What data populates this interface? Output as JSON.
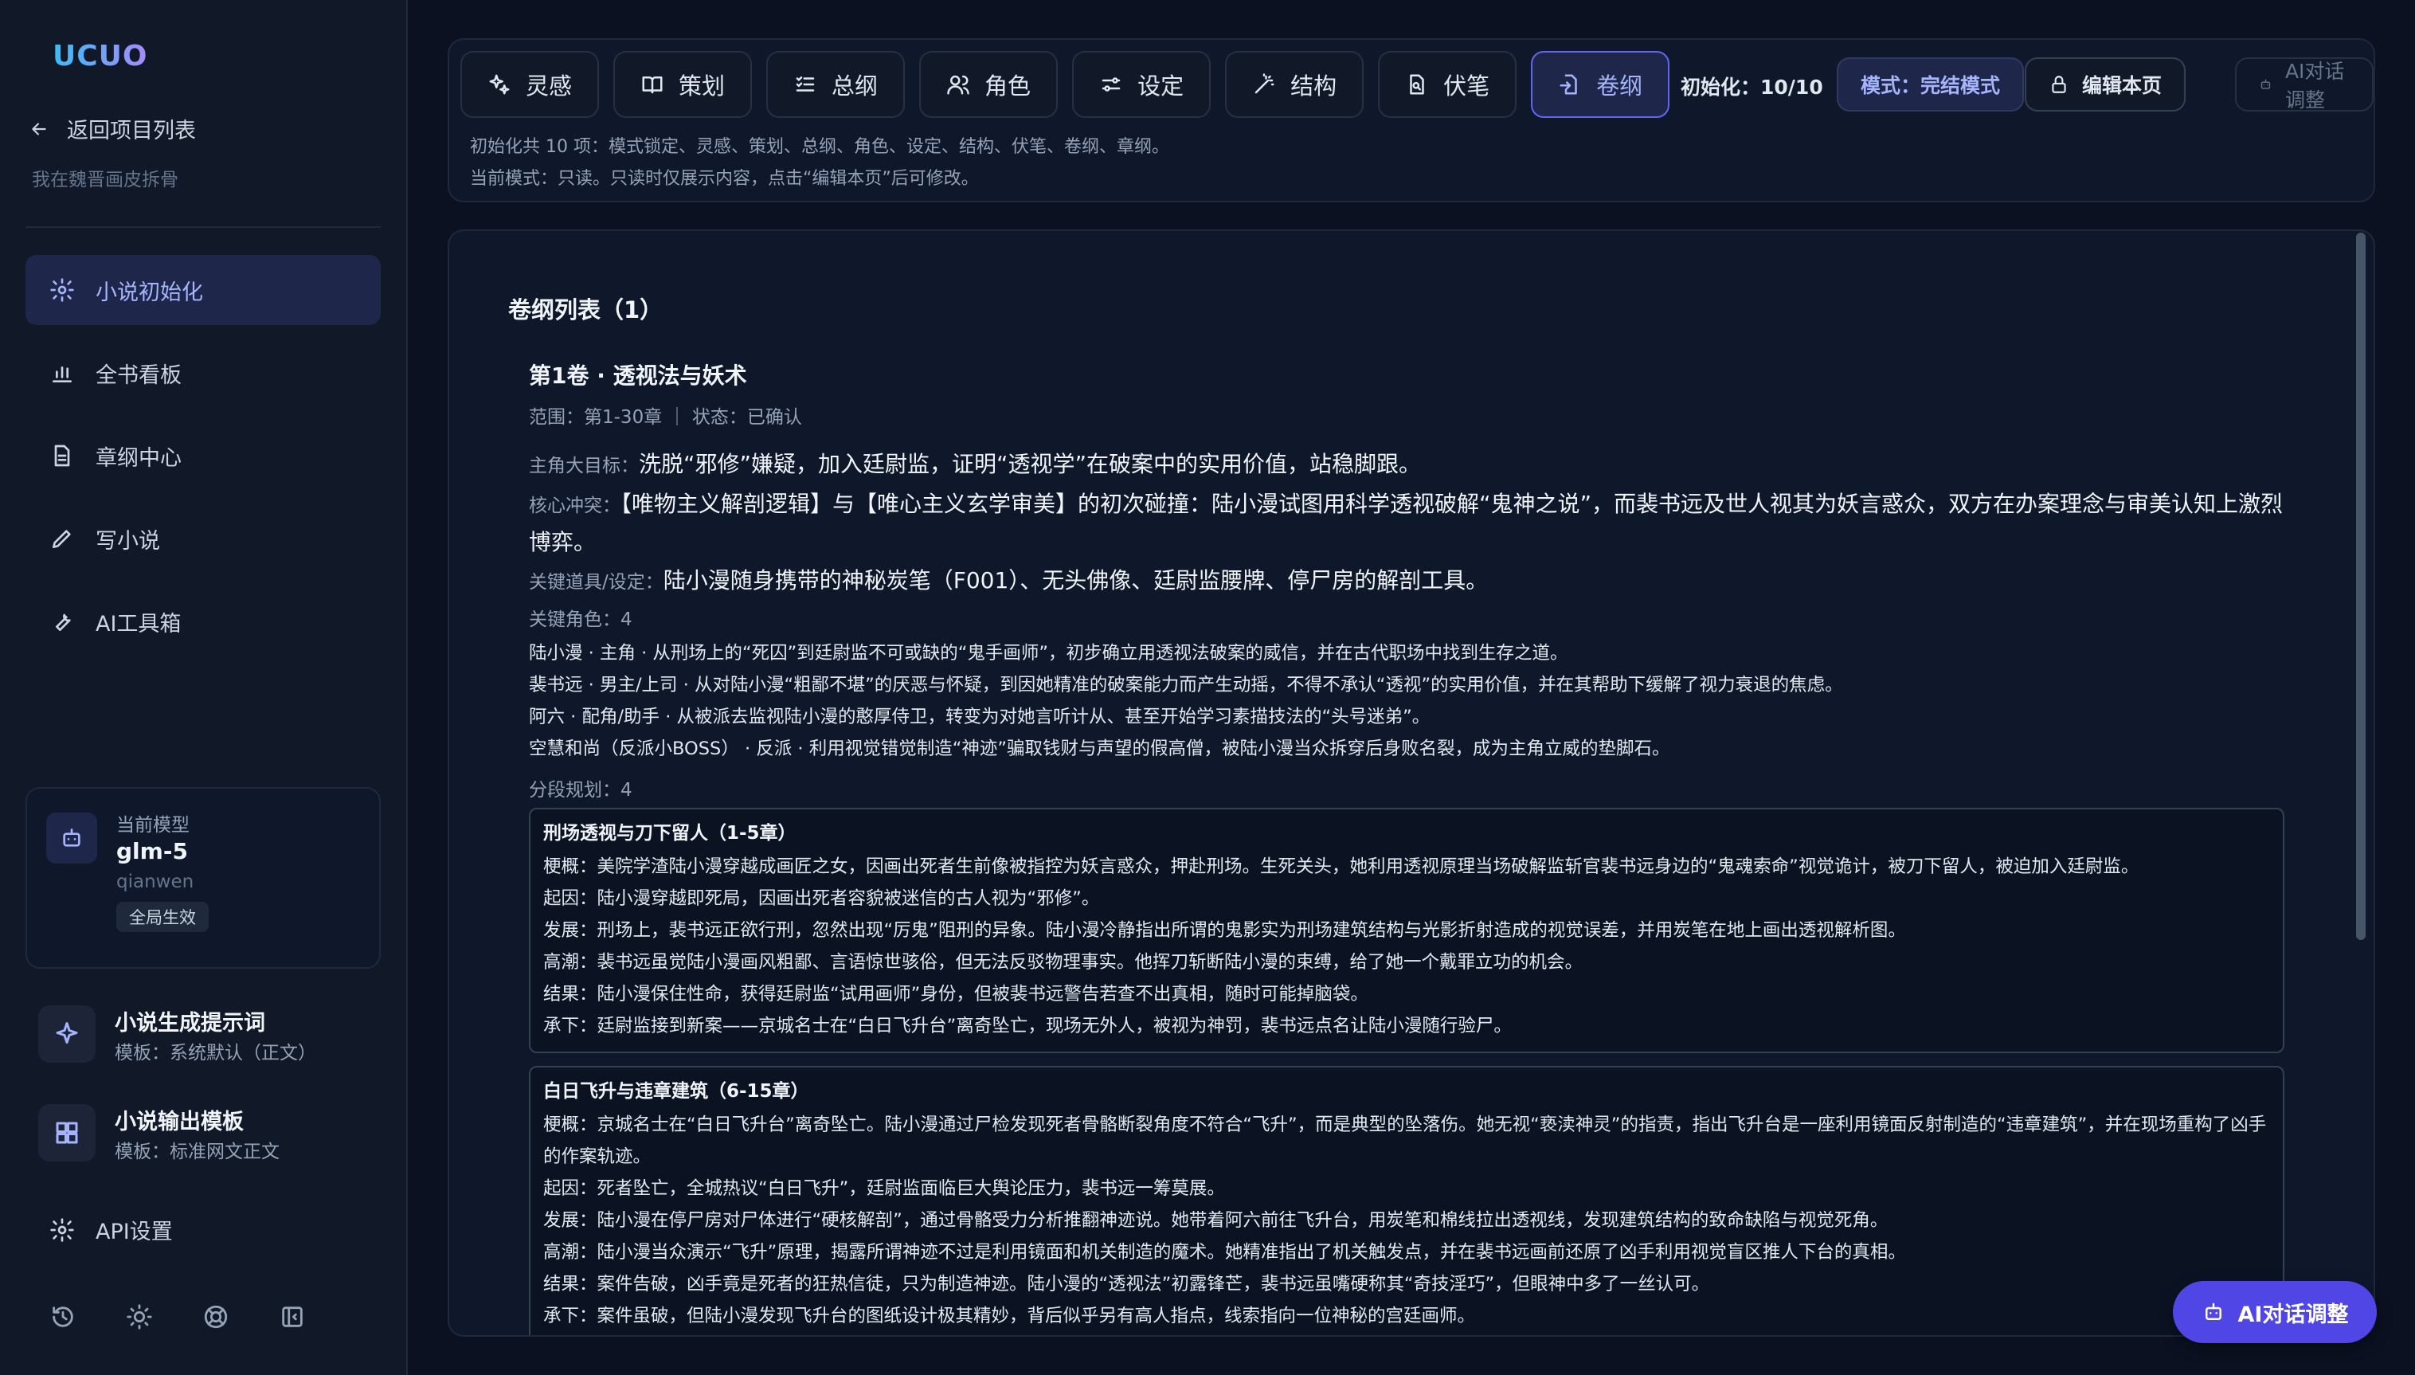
{
  "sidebar": {
    "logo": "UCUO",
    "back": "返回项目列表",
    "project": "我在魏晋画皮拆骨",
    "nav": [
      {
        "label": "小说初始化",
        "icon": "gear-icon"
      },
      {
        "label": "全书看板",
        "icon": "bar-chart-icon"
      },
      {
        "label": "章纲中心",
        "icon": "document-icon"
      },
      {
        "label": "写小说",
        "icon": "pencil-icon"
      },
      {
        "label": "AI工具箱",
        "icon": "wrench-icon"
      }
    ],
    "model": {
      "label": "当前模型",
      "name": "glm-5",
      "provider": "qianwen",
      "badge": "全局生效"
    },
    "prompt_tpl": {
      "title": "小说生成提示词",
      "sub": "模板：系统默认（正文）"
    },
    "output_tpl": {
      "title": "小说输出模板",
      "sub": "模板：标准网文正文"
    },
    "api": "API设置"
  },
  "toolbar": {
    "tabs": [
      {
        "label": "灵感",
        "icon": "sparkle-icon"
      },
      {
        "label": "策划",
        "icon": "book-open-icon"
      },
      {
        "label": "总纲",
        "icon": "list-check-icon"
      },
      {
        "label": "角色",
        "icon": "users-icon"
      },
      {
        "label": "设定",
        "icon": "sliders-icon"
      },
      {
        "label": "结构",
        "icon": "wand-icon"
      },
      {
        "label": "伏笔",
        "icon": "file-search-icon"
      },
      {
        "label": "卷纲",
        "icon": "file-import-icon"
      }
    ],
    "init_count": "初始化：10/10",
    "mode": "模式：完结模式",
    "edit": "编辑本页",
    "ai": "AI对话调整",
    "hint1": "初始化共 10 项：模式锁定、灵感、策划、总纲、角色、设定、结构、伏笔、卷纲、章纲。",
    "hint2": "当前模式：只读。只读时仅展示内容，点击“编辑本页”后可修改。"
  },
  "main": {
    "list_title": "卷纲列表（1）",
    "volume": {
      "title": "第1卷 · 透视法与妖术",
      "meta": "范围：第1-30章 ｜ 状态：已确认",
      "goal_label": "主角大目标：",
      "goal": "洗脱“邪修”嫌疑，加入廷尉监，证明“透视学”在破案中的实用价值，站稳脚跟。",
      "conflict_label": "核心冲突：",
      "conflict": "【唯物主义解剖逻辑】与【唯心主义玄学审美】的初次碰撞：陆小漫试图用科学透视破解“鬼神之说”，而裴书远及世人视其为妖言惑众，双方在办案理念与审美认知上激烈博弈。",
      "props_label": "关键道具/设定：",
      "props": "陆小漫随身携带的神秘炭笔（F001）、无头佛像、廷尉监腰牌、停尸房的解剖工具。",
      "chars_label": "关键角色：4",
      "chars": [
        "陆小漫 · 主角 · 从刑场上的“死囚”到廷尉监不可或缺的“鬼手画师”，初步确立用透视法破案的威信，并在古代职场中找到生存之道。",
        "裴书远 · 男主/上司 · 从对陆小漫“粗鄙不堪”的厌恶与怀疑，到因她精准的破案能力而产生动摇，不得不承认“透视”的实用价值，并在其帮助下缓解了视力衰退的焦虑。",
        "阿六 · 配角/助手 · 从被派去监视陆小漫的憨厚侍卫，转变为对她言听计从、甚至开始学习素描技法的“头号迷弟”。",
        "空慧和尚（反派小BOSS） · 反派 · 利用视觉错觉制造“神迹”骗取钱财与声望的假高僧，被陆小漫当众拆穿后身败名裂，成为主角立威的垫脚石。"
      ],
      "segments_label": "分段规划：4",
      "segments": [
        {
          "title": "刑场透视与刀下留人（1-5章）",
          "lines": [
            "梗概：美院学渣陆小漫穿越成画匠之女，因画出死者生前像被指控为妖言惑众，押赴刑场。生死关头，她利用透视原理当场破解监斩官裴书远身边的“鬼魂索命”视觉诡计，被刀下留人，被迫加入廷尉监。",
            "起因：陆小漫穿越即死局，因画出死者容貌被迷信的古人视为“邪修”。",
            "发展：刑场上，裴书远正欲行刑，忽然出现“厉鬼”阻刑的异象。陆小漫冷静指出所谓的鬼影实为刑场建筑结构与光影折射造成的视觉误差，并用炭笔在地上画出透视解析图。",
            "高潮：裴书远虽觉陆小漫画风粗鄙、言语惊世骇俗，但无法反驳物理事实。他挥刀斩断陆小漫的束缚，给了她一个戴罪立功的机会。",
            "结果：陆小漫保住性命，获得廷尉监“试用画师”身份，但被裴书远警告若查不出真相，随时可能掉脑袋。",
            "承下：廷尉监接到新案——京城名士在“白日飞升台”离奇坠亡，现场无外人，被视为神罚，裴书远点名让陆小漫随行验尸。"
          ]
        },
        {
          "title": "白日飞升与违章建筑（6-15章）",
          "lines": [
            "梗概：京城名士在“白日飞升台”离奇坠亡。陆小漫通过尸检发现死者骨骼断裂角度不符合“飞升”，而是典型的坠落伤。她无视“亵渎神灵”的指责，指出飞升台是一座利用镜面反射制造的“违章建筑”，并在现场重构了凶手的作案轨迹。",
            "起因：死者坠亡，全城热议“白日飞升”，廷尉监面临巨大舆论压力，裴书远一筹莫展。",
            "发展：陆小漫在停尸房对尸体进行“硬核解剖”，通过骨骼受力分析推翻神迹说。她带着阿六前往飞升台，用炭笔和棉线拉出透视线，发现建筑结构的致命缺陷与视觉死角。",
            "高潮：陆小漫当众演示“飞升”原理，揭露所谓神迹不过是利用镜面和机关制造的魔术。她精准指出了机关触发点，并在裴书远画前还原了凶手利用视觉盲区推人下台的真相。",
            "结果：案件告破，凶手竟是死者的狂热信徒，只为制造神迹。陆小漫的“透视法”初露锋芒，裴书远虽嘴硬称其“奇技淫巧”，但眼神中多了一丝认可。",
            "承下：案件虽破，但陆小漫发现飞升台的图纸设计极其精妙，背后似乎另有高人指点，线索指向一位神秘的宫廷画师。"
          ]
        }
      ]
    }
  },
  "float_ai": "AI对话调整",
  "colors": {
    "accent": "#6366f1",
    "accent_text": "#a5b4fc",
    "bg": "#0b1120",
    "panel": "#0f172a"
  }
}
